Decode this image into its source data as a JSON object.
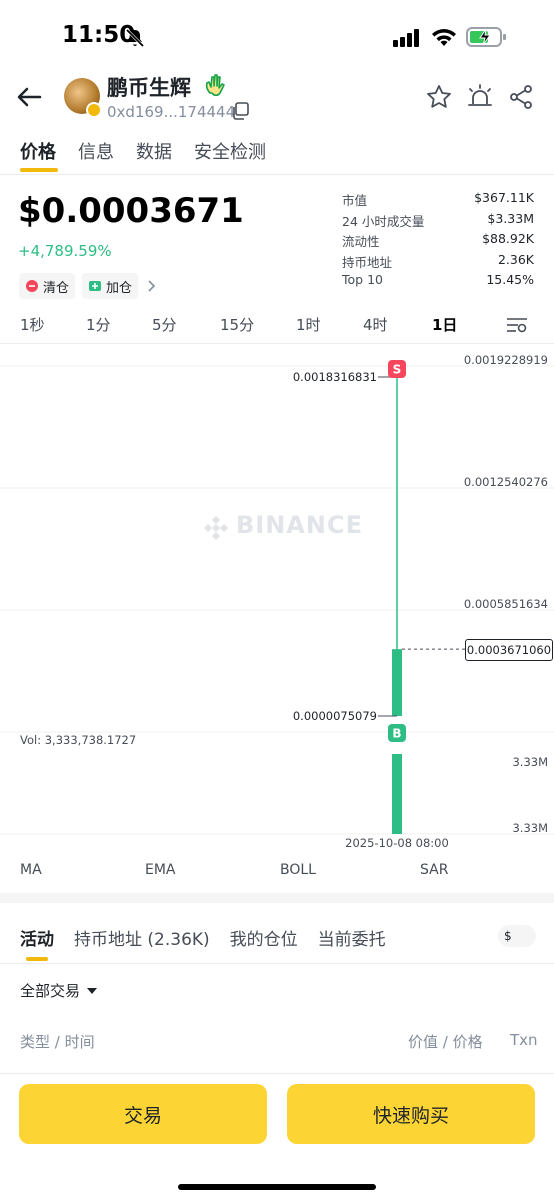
{
  "status_bar": {
    "time": "11:50"
  },
  "header": {
    "token_name": "鹏币生辉",
    "address": "0xd169...174444"
  },
  "tabs": [
    {
      "label": "价格"
    },
    {
      "label": "信息"
    },
    {
      "label": "数据"
    },
    {
      "label": "安全检测"
    }
  ],
  "price_section": {
    "price": "$0.0003671",
    "change": "+4,789.59%",
    "chips": [
      {
        "label": "清仓"
      },
      {
        "label": "加仓"
      }
    ]
  },
  "stats": [
    {
      "label": "市值",
      "value": "$367.11K"
    },
    {
      "label": "24 小时成交量",
      "value": "$3.33M"
    },
    {
      "label": "流动性",
      "value": "$88.92K"
    },
    {
      "label": "持币地址",
      "value": "2.36K"
    },
    {
      "label": "Top 10",
      "value": "15.45%"
    }
  ],
  "intervals": [
    "1秒",
    "1分",
    "5分",
    "15分",
    "1时",
    "4时",
    "1日"
  ],
  "active_interval": "1日",
  "chart_data": {
    "type": "candlestick",
    "watermark": "BINANCE",
    "y_axis_ticks": [
      "0.0019228919",
      "0.0012540276",
      "0.0005851634"
    ],
    "current_price_label": "0.0003671060",
    "high_label": "0.0018316831",
    "low_label": "0.0000075079",
    "candle": {
      "open": 7.5079e-06,
      "high": 0.0018316831,
      "low": 7.5079e-06,
      "close": 0.000367106
    },
    "ylim": [
      7.5079e-06,
      0.0019228919
    ],
    "volume": {
      "label": "Vol: 3,333,738.1727",
      "tick_top": "3.33M",
      "tick_bottom": "3.33M",
      "value": 3333738.1727
    },
    "x_label": "2025-10-08 08:00",
    "markers": [
      {
        "label": "S",
        "color": "#f6465d"
      },
      {
        "label": "B",
        "color": "#2ebd85"
      }
    ],
    "up_color": "#2ebd85"
  },
  "indicators": [
    "MA",
    "EMA",
    "BOLL",
    "SAR"
  ],
  "bottom_tabs": [
    {
      "label": "活动"
    },
    {
      "label": "持币地址 (2.36K)"
    },
    {
      "label": "我的仓位"
    },
    {
      "label": "当前委托"
    }
  ],
  "currency_toggle": "$",
  "filter_label": "全部交易",
  "columns": {
    "left": "类型 / 时间",
    "middle": "价值 / 价格",
    "right": "Txn"
  },
  "buttons": {
    "trade": "交易",
    "quick_buy": "快速购买"
  }
}
